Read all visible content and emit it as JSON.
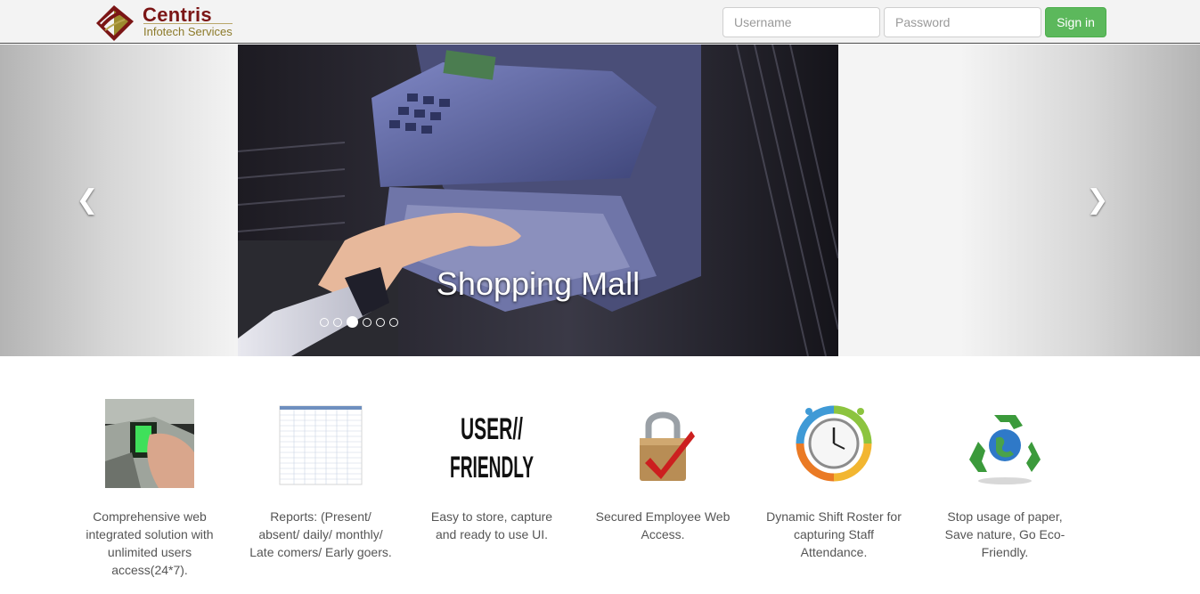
{
  "brand": {
    "name": "Centris",
    "tagline": "Infotech Services"
  },
  "login": {
    "username_placeholder": "Username",
    "password_placeholder": "Password",
    "signin_label": "Sign in"
  },
  "carousel": {
    "caption": "Shopping Mall",
    "slide_count": 6,
    "active_index": 2,
    "prev_icon": "chevron-left-icon",
    "next_icon": "chevron-right-icon"
  },
  "features": [
    {
      "icon": "fingerprint-scanner-icon",
      "text": "Comprehensive web integrated solution with unlimited users access(24*7)."
    },
    {
      "icon": "attendance-sheet-icon",
      "text": "Reports: (Present/ absent/ daily/ monthly/ Late comers/ Early goers."
    },
    {
      "icon": "user-friendly-icon",
      "text": "Easy to store, capture and ready to use UI.",
      "icon_text_1": "USER//",
      "icon_text_2": "FRIENDLY"
    },
    {
      "icon": "padlock-check-icon",
      "text": "Secured Employee Web Access."
    },
    {
      "icon": "clock-roster-icon",
      "text": "Dynamic Shift Roster for capturing Staff Attendance."
    },
    {
      "icon": "recycle-globe-icon",
      "text": "Stop usage of paper, Save nature, Go Eco-Friendly."
    }
  ],
  "colors": {
    "brand_red": "#7b1515",
    "brand_gold": "#8c7a2a",
    "signin_green": "#5cb85c"
  }
}
